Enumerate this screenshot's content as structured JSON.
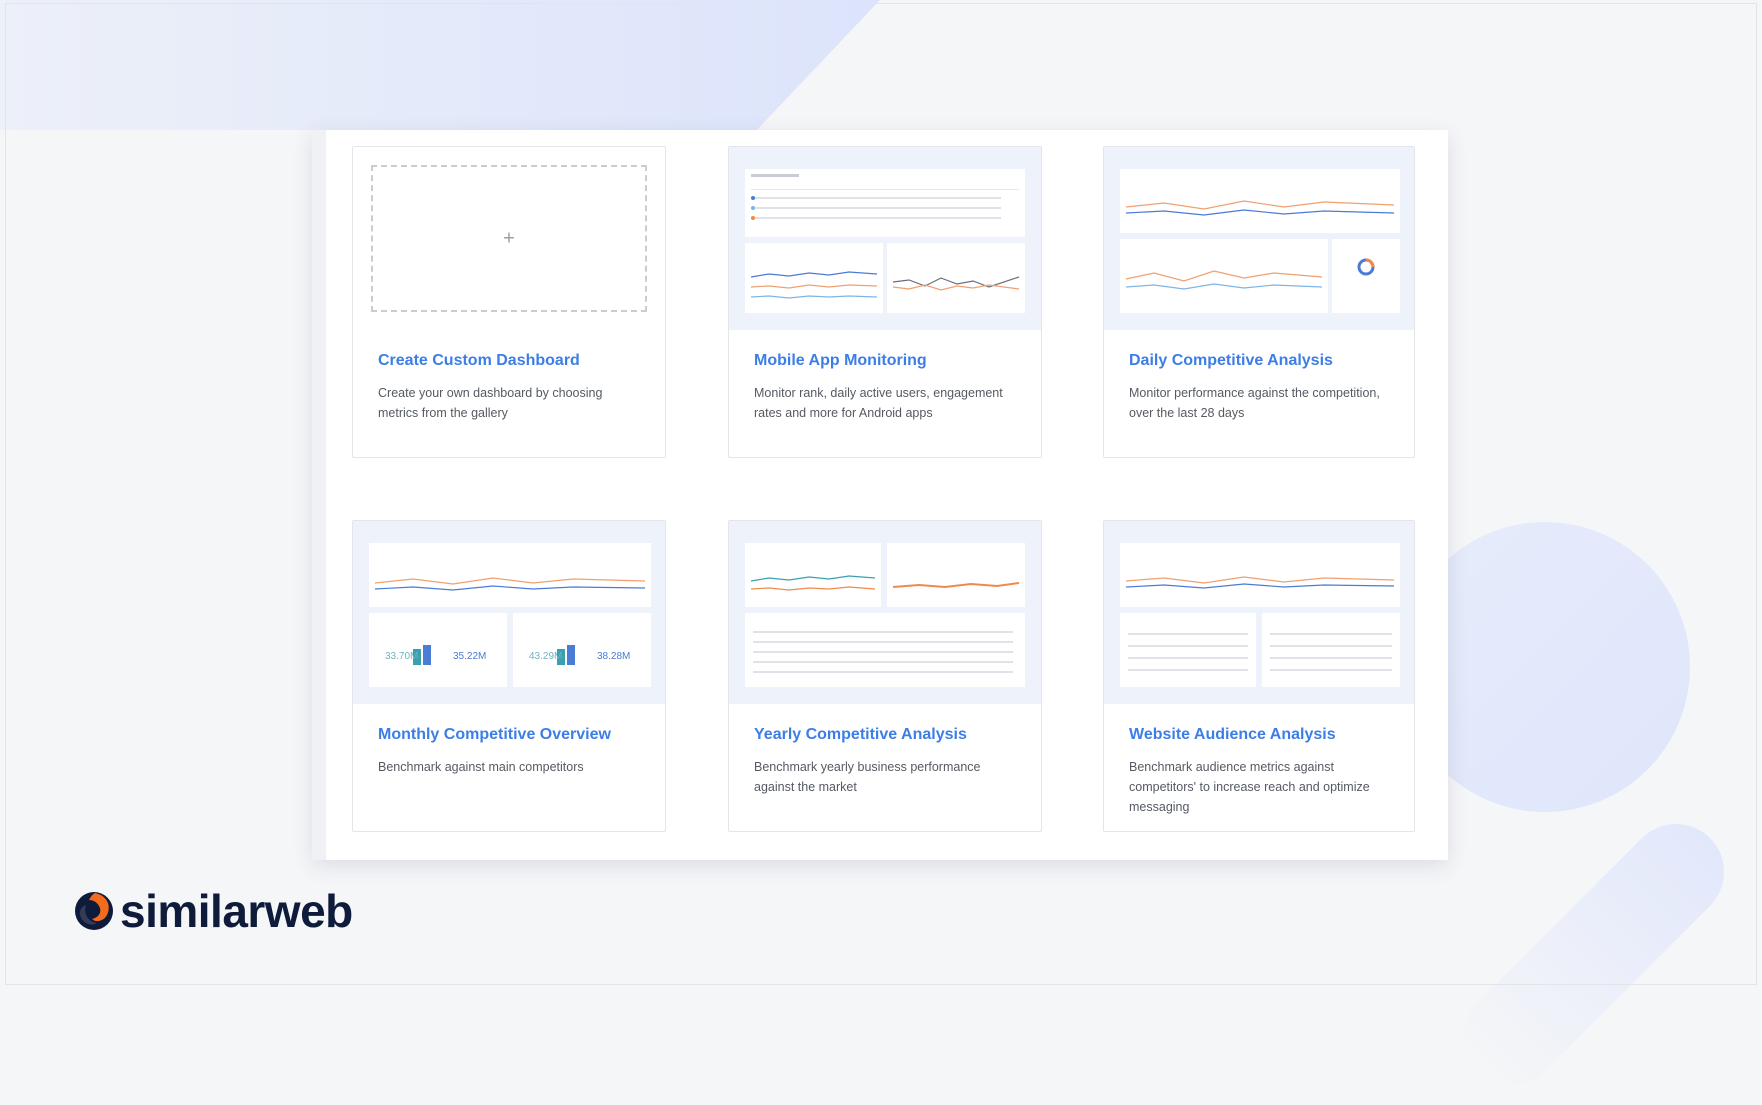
{
  "brand": {
    "name": "similarweb",
    "accent": "#3d7ee6",
    "logo_orange": "#f36b1c",
    "logo_navy": "#0f1b3a"
  },
  "cards": [
    {
      "title": "Create Custom Dashboard",
      "description": "Create your own dashboard by choosing metrics from the gallery",
      "action_icon": "plus-icon"
    },
    {
      "title": "Mobile App Monitoring",
      "description": "Monitor rank, daily active users, engagement rates and more for Android apps"
    },
    {
      "title": "Daily Competitive Analysis",
      "description": "Monitor performance against the competition, over the last 28 days"
    },
    {
      "title": "Monthly Competitive Overview",
      "description": "Benchmark against main competitors",
      "metrics": [
        "33.70M",
        "35.22M",
        "43.29M",
        "38.28M"
      ]
    },
    {
      "title": "Yearly Competitive Analysis",
      "description": "Benchmark yearly business performance against the market"
    },
    {
      "title": "Website Audience Analysis",
      "description": "Benchmark audience metrics against competitors' to increase reach and optimize messaging"
    }
  ]
}
